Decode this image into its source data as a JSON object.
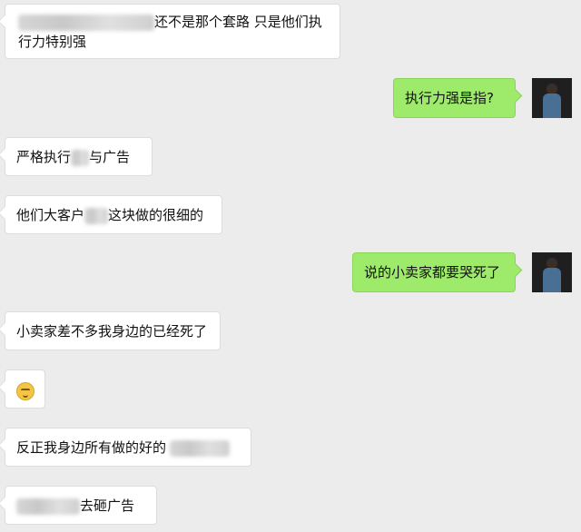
{
  "messages": [
    {
      "dir": "in",
      "parts": {
        "a": "还不是那个套路 只是他们执",
        "b": "行力特别强"
      }
    },
    {
      "dir": "out",
      "text": "执行力强是指?"
    },
    {
      "dir": "in",
      "parts": {
        "a": "严格执行",
        "b": "与广告"
      }
    },
    {
      "dir": "in",
      "parts": {
        "a": "他们大客户",
        "b": "这块做的很细的"
      }
    },
    {
      "dir": "out",
      "text": "说的小卖家都要哭死了"
    },
    {
      "dir": "in",
      "text": "小卖家差不多我身边的已经死了"
    },
    {
      "dir": "in",
      "emoji": "face-emoji"
    },
    {
      "dir": "in",
      "parts": {
        "a": "反正我身边所有做的好的"
      }
    },
    {
      "dir": "in",
      "parts": {
        "b": "去砸广告"
      }
    }
  ],
  "avatar": {
    "label": "user-avatar"
  }
}
